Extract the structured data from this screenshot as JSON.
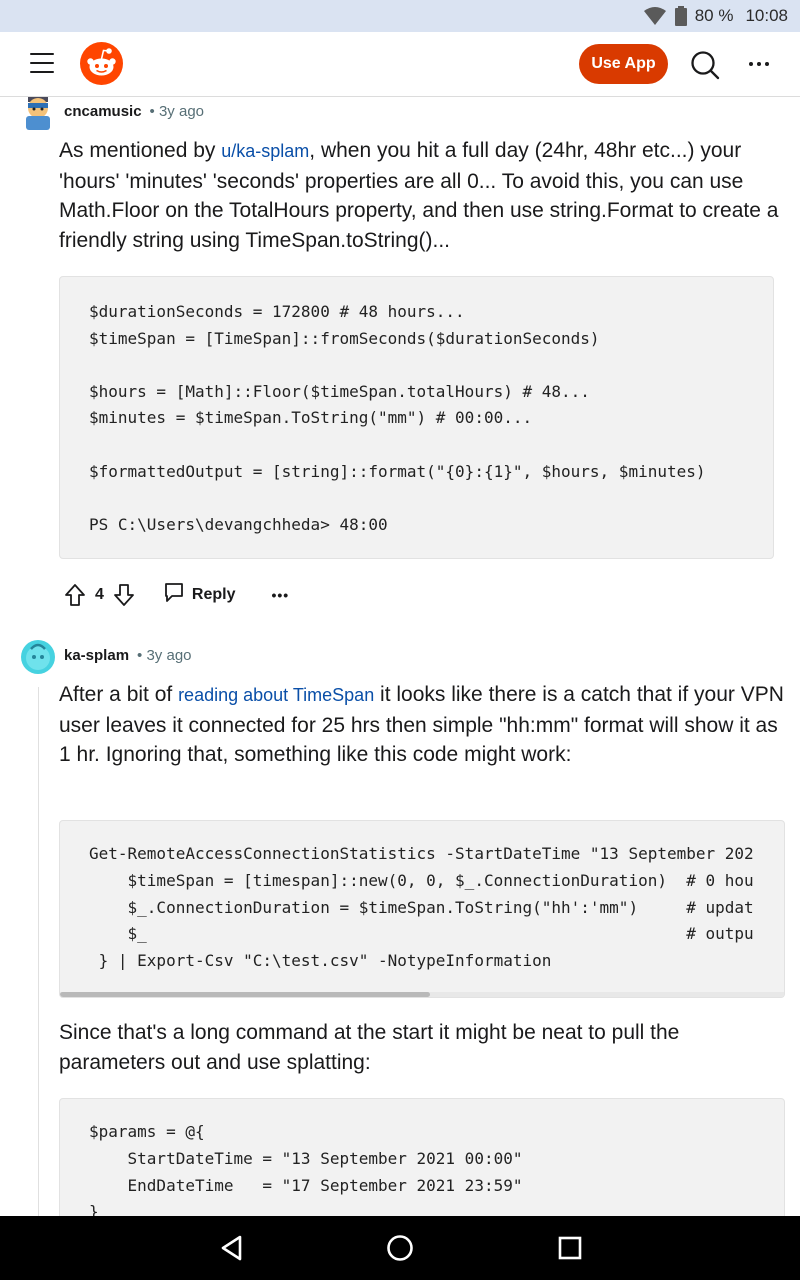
{
  "status_bar": {
    "battery": "80 %",
    "time": "10:08"
  },
  "app_bar": {
    "use_app_label": "Use App"
  },
  "comments": [
    {
      "author": "cncamusic",
      "age": "3y ago",
      "text_before_link": "As mentioned by ",
      "link": "u/ka-splam",
      "text_after_link": ", when you hit a full day (24hr, 48hr etc...) your 'hours' 'minutes' 'seconds' properties are all 0... To avoid this, you can use Math.Floor on the TotalHours property, and then use string.Format to create a friendly string using TimeSpan.toString()...",
      "code_lines": [
        "$durationSeconds = 172800 # 48 hours...",
        "$timeSpan = [TimeSpan]::fromSeconds($durationSeconds)",
        "",
        "$hours = [Math]::Floor($timeSpan.totalHours) # 48...",
        "$minutes = $timeSpan.ToString(\"mm\") # 00:00...",
        "",
        "$formattedOutput = [string]::format(\"{0}:{1}\", $hours, $minutes)",
        "",
        "PS C:\\Users\\devangchheda> 48:00"
      ],
      "votes": "4",
      "reply_label": "Reply"
    },
    {
      "author": "ka-splam",
      "age": "3y ago",
      "text_before_link": "After a bit of ",
      "link": "reading about TimeSpan",
      "text_after_link": " it looks like there is a catch that if your VPN user leaves it connected for 25 hrs then simple \"hh:mm\" format will show it as 1 hr. Ignoring that, something like this code might work:",
      "code_lines": [
        "Get-RemoteAccessConnectionStatistics -StartDateTime \"13 September 202",
        "    $timeSpan = [timespan]::new(0, 0, $_.ConnectionDuration)  # 0 hou",
        "    $_.ConnectionDuration = $timeSpan.ToString(\"hh':'mm\")     # updat",
        "    $_                                                        # outpu",
        " } | Export-Csv \"C:\\test.csv\" -NotypeInformation"
      ],
      "text2": "Since that's a long command at the start it might be neat to pull the parameters out and use splatting:",
      "code2_lines": [
        "$params = @{",
        "    StartDateTime = \"13 September 2021 00:00\"",
        "    EndDateTime   = \"17 September 2021 23:59\"",
        "}"
      ]
    }
  ]
}
